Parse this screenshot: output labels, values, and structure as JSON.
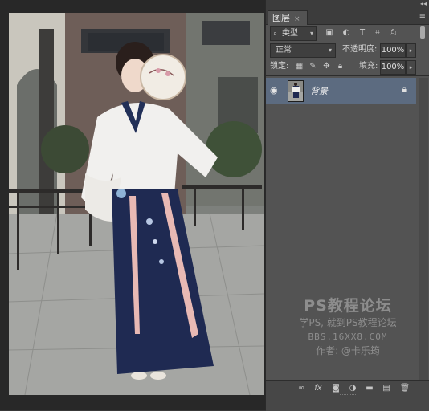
{
  "panel": {
    "tab_label": "图层",
    "tab_close": "×",
    "collapse": "◂◂",
    "menu": "≡",
    "filter": {
      "kind": "类型",
      "icons": [
        "image-filter-icon",
        "adjustment-filter-icon",
        "type-filter-icon",
        "shape-filter-icon",
        "smart-object-filter-icon"
      ]
    },
    "blend_mode": "正常",
    "opacity_label": "不透明度:",
    "opacity_value": "100%",
    "lock_label": "锁定:",
    "fill_label": "填充:",
    "fill_value": "100%",
    "layers": [
      {
        "name": "背景",
        "visible": true,
        "locked": true,
        "selected": true
      }
    ],
    "bottom_icons": [
      "link-layers-icon",
      "fx-icon",
      "add-mask-icon",
      "adjustment-layer-icon",
      "new-group-icon",
      "new-layer-icon",
      "delete-layer-icon"
    ]
  },
  "watermark": {
    "line1": "PS教程论坛",
    "line2": "学PS, 就到PS教程论坛",
    "line3": "BBS.16XX8.COM",
    "line4": "作者: @卡乐筠"
  },
  "colors": {
    "panel_bg": "#535353",
    "selected_layer": "#5c6b80",
    "canvas_bg": "#282828"
  }
}
